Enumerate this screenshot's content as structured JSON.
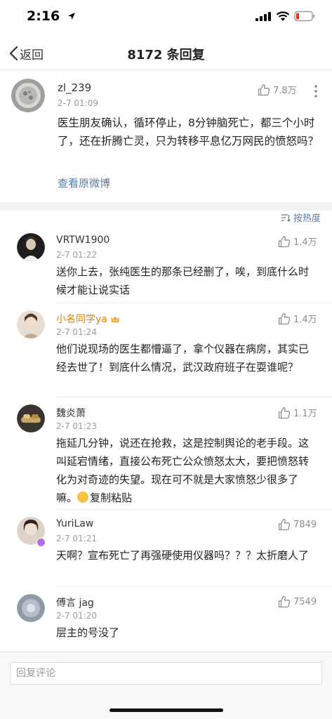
{
  "status_bar": {
    "time": "2:16"
  },
  "nav": {
    "back_label": "返回",
    "title": "8172 条回复"
  },
  "post": {
    "user_name": "zl_239",
    "timestamp": "2-7 01:09",
    "likes": "7.8万",
    "content": "医生朋友确认，循环停止，8分钟脑死亡，都三个小时了，还在折腾亡灵，只为转移平息亿万网民的愤怒吗？",
    "view_original": "查看原微博"
  },
  "sort": {
    "label": "按热度"
  },
  "comments": [
    {
      "user_name": "VRTW1900",
      "timestamp": "2-7 01:22",
      "likes": "1.4万",
      "content": "送你上去，张纯医生的那条已经删了，唉，到底什么时候才能让说实话"
    },
    {
      "user_name": "小名同学ya",
      "timestamp": "2-7 01:24",
      "likes": "1.4万",
      "content": "他们说现场的医生都懵逼了，拿个仪器在病房，其实已经去世了！到底什么情况，武汉政府班子在耍谁呢？",
      "name_color": "#e87e04"
    },
    {
      "user_name": "魏炎萧",
      "timestamp": "2-7 01:23",
      "likes": "1.1万",
      "content": "拖延几分钟，说还在抢救，这是控制舆论的老手段。这叫延宕情绪，直接公布死亡公众愤怒太大，要把愤怒转化为对奇迹的失望。现在可不就是大家愤怒少很多了嘛。",
      "content_suffix": "复制粘贴"
    },
    {
      "user_name": "YuriLaw",
      "timestamp": "2-7 01:21",
      "likes": "7849",
      "content": "天啊？宣布死亡了再强硬使用仪器吗？？？太折磨人了"
    },
    {
      "user_name": "傅言 jag",
      "timestamp": "2-7 01:20",
      "likes": "7549",
      "content": "层主的号没了"
    }
  ],
  "reply_bar": {
    "placeholder": "回复评论"
  },
  "colors": {
    "link": "#5b7aa5",
    "meta": "#9b9b9b",
    "band": "#f2f2f2"
  }
}
